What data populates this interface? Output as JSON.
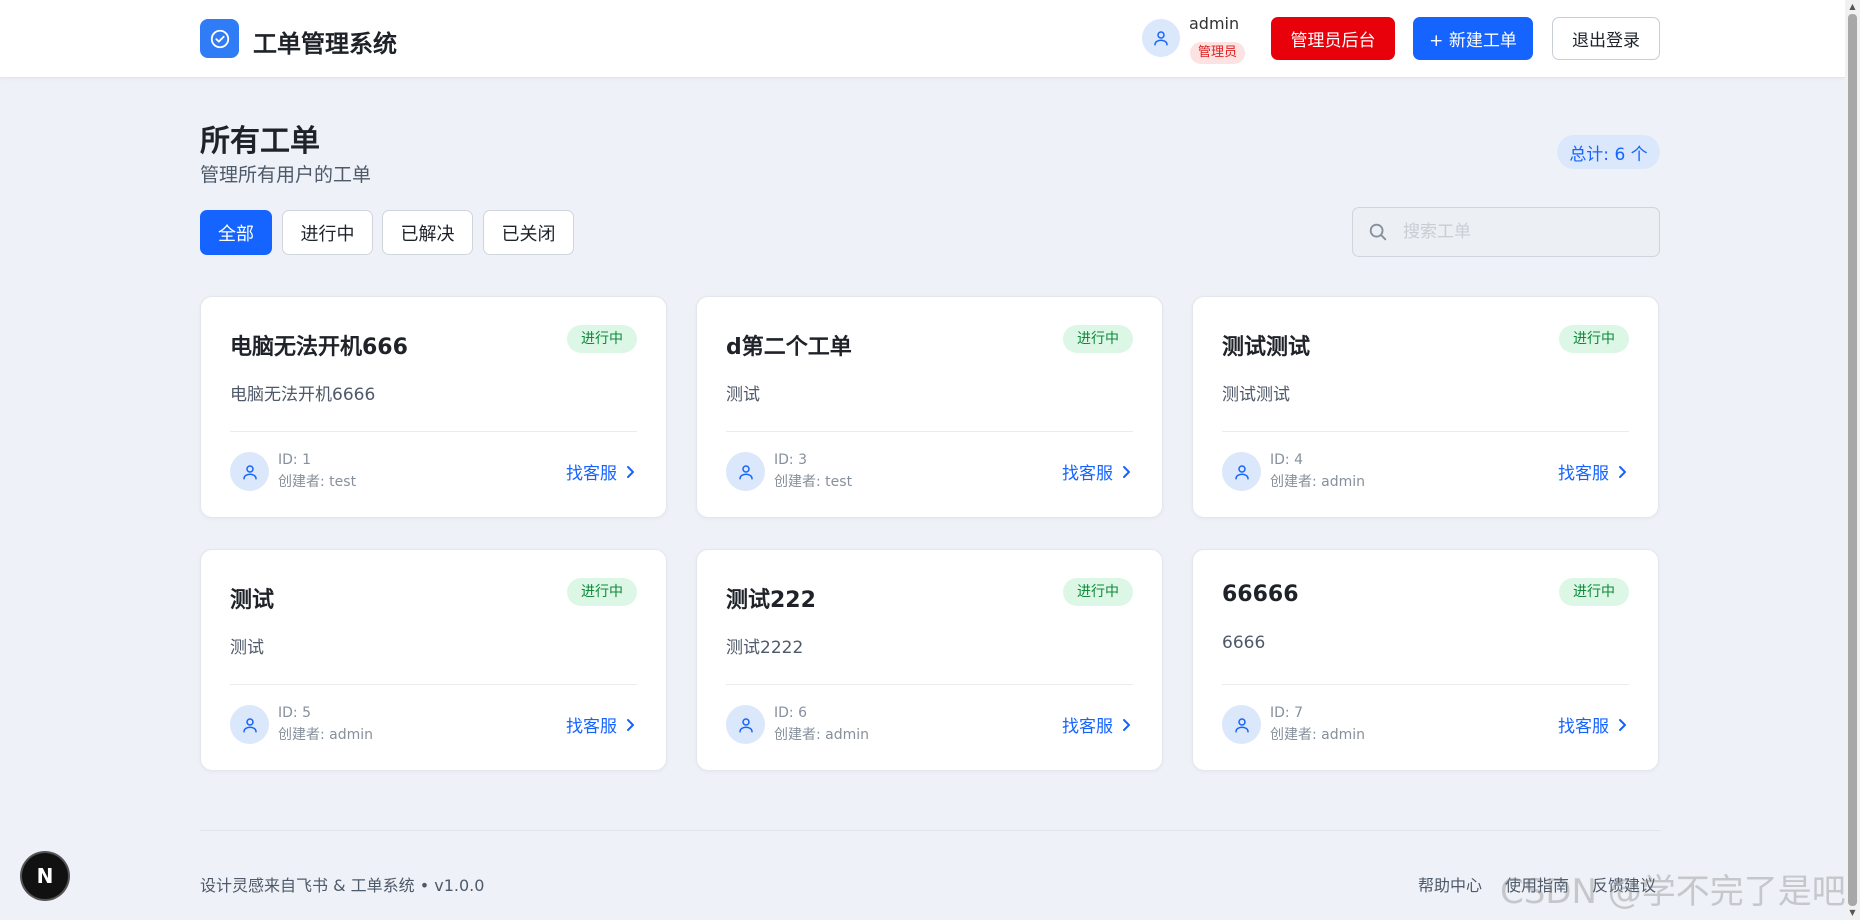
{
  "header": {
    "app_title": "工单管理系统",
    "user_name": "admin",
    "role": "管理员",
    "admin_button": "管理员后台",
    "new_ticket_button": "+ 新建工单",
    "logout_button": "退出登录"
  },
  "page": {
    "title": "所有工单",
    "subtitle": "管理所有用户的工单",
    "total": "总计: 6 个"
  },
  "filters": {
    "all": "全部",
    "in_progress": "进行中",
    "resolved": "已解决",
    "closed": "已关闭"
  },
  "search": {
    "placeholder": "搜索工单"
  },
  "tickets": [
    {
      "title": "电脑无法开机666",
      "status": "进行中",
      "desc": "电脑无法开机6666",
      "id": "ID: 1",
      "creator": "创建者: test",
      "link": "找客服"
    },
    {
      "title": "d第二个工单",
      "status": "进行中",
      "desc": "测试",
      "id": "ID: 3",
      "creator": "创建者: test",
      "link": "找客服"
    },
    {
      "title": "测试测试",
      "status": "进行中",
      "desc": "测试测试",
      "id": "ID: 4",
      "creator": "创建者: admin",
      "link": "找客服"
    },
    {
      "title": "测试",
      "status": "进行中",
      "desc": "测试",
      "id": "ID: 5",
      "creator": "创建者: admin",
      "link": "找客服"
    },
    {
      "title": "测试222",
      "status": "进行中",
      "desc": "测试2222",
      "id": "ID: 6",
      "creator": "创建者: admin",
      "link": "找客服"
    },
    {
      "title": "66666",
      "status": "进行中",
      "desc": "6666",
      "id": "ID: 7",
      "creator": "创建者: admin",
      "link": "找客服"
    }
  ],
  "footer": {
    "text": "设计灵感来自飞书 & 工单系统 • v1.0.0",
    "links": [
      "帮助中心",
      "使用指南",
      "反馈建议"
    ]
  },
  "watermark": "CSDN @学不完了是吧",
  "dev_badge": "N",
  "colors": {
    "primary": "#1664ff",
    "danger": "#e8000b",
    "status_green": "#0e8a3a",
    "status_green_bg": "#dcf7e6"
  }
}
